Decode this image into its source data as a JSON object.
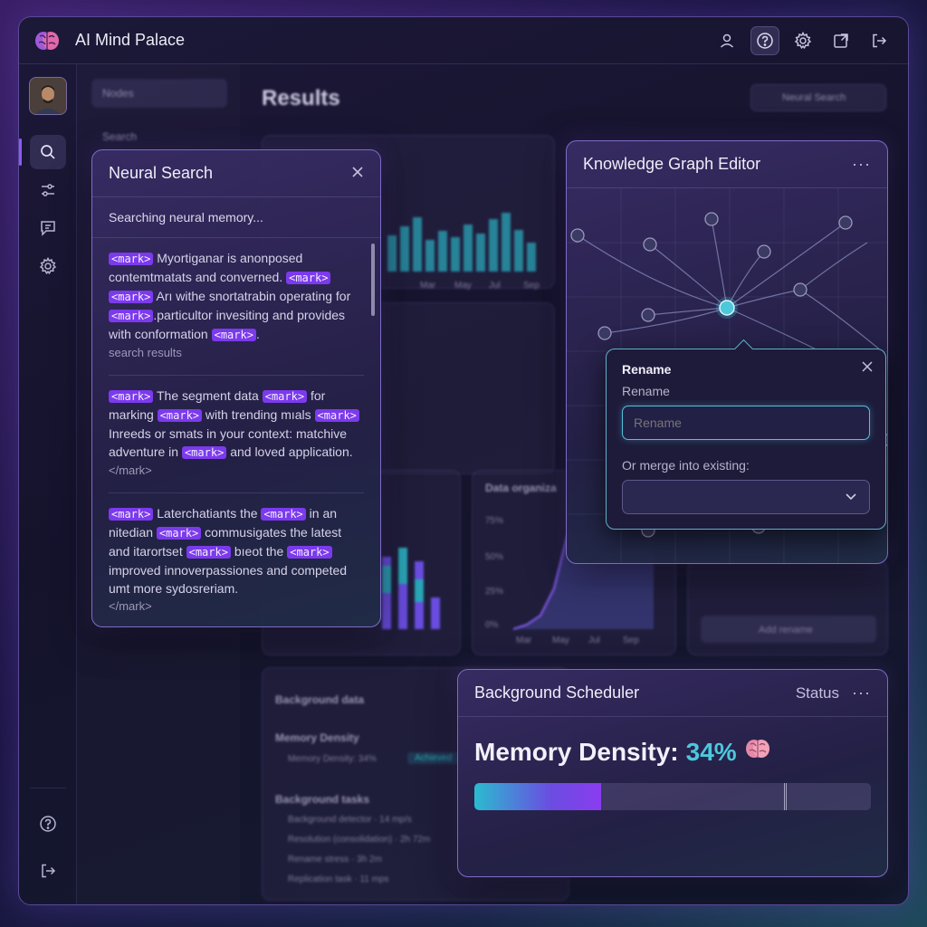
{
  "app": {
    "title": "AI Mind Palace"
  },
  "background": {
    "nav_items": [
      "Nodes",
      "Search"
    ],
    "main_title": "Results",
    "main_dropdown": "Neural Search",
    "axis_months": [
      "Mar",
      "May",
      "Jul",
      "Sep"
    ],
    "card_labels": {
      "data_organization": "Data organiza",
      "background_data": "Background data",
      "memory_density": "Memory Density",
      "memory_density_row": "Memory Density: 34%",
      "memory_density_badge": "Achieved",
      "background_tasks": "Background tasks",
      "add_rename": "Add rename"
    },
    "task_rows": [
      "Background detector · 14 mp/s",
      "Resolution (consolidation) · 2h 72m",
      "Rename stress · 3h 2m",
      "Replication task · 11 mps"
    ],
    "y_ticks": [
      "75%",
      "50%",
      "25%",
      "0%"
    ]
  },
  "neural_search": {
    "title": "Neural Search",
    "status": "Searching neural memory...",
    "results": [
      {
        "parts": [
          {
            "m": "<mark>"
          },
          {
            "t": " Myortiganar is anonposed contemtmatats and converned. "
          },
          {
            "m": "<mark>"
          },
          {
            "t": " "
          },
          {
            "m": "<mark>"
          },
          {
            "t": " Arı withe snortatrabin operating for "
          },
          {
            "m": "<mark>"
          },
          {
            "t": ".particultor invesiting and provides with conformation "
          },
          {
            "m": "<mark>"
          },
          {
            "t": "."
          }
        ],
        "footer": "search results"
      },
      {
        "parts": [
          {
            "m": "<mark>"
          },
          {
            "t": " The segment data "
          },
          {
            "m": "<mark>"
          },
          {
            "t": " for marking "
          },
          {
            "m": "<mark>"
          },
          {
            "t": " with trending mıals "
          },
          {
            "m": "<mark>"
          },
          {
            "t": " Inreeds or smats in your context: matchive adventure in "
          },
          {
            "m": "<mark>"
          },
          {
            "t": " and loved application."
          }
        ],
        "footer": "</mark>"
      },
      {
        "parts": [
          {
            "m": "<mark>"
          },
          {
            "t": " Laterchatiants the "
          },
          {
            "m": "<mark>"
          },
          {
            "t": " in an nitedian "
          },
          {
            "m": "<mark>"
          },
          {
            "t": " commusigates the latest and itarortset "
          },
          {
            "m": "<mark>"
          },
          {
            "t": " bıeot the "
          },
          {
            "m": "<mark>"
          },
          {
            "t": " improved innoverpassiones and competed umt more sydosreriam."
          }
        ],
        "footer": "</mark>"
      }
    ]
  },
  "graph_editor": {
    "title": "Knowledge Graph Editor",
    "rename": {
      "title": "Rename",
      "label": "Rename",
      "placeholder": "Rename",
      "merge_label": "Or merge into existing:"
    }
  },
  "scheduler": {
    "title": "Background Scheduler",
    "status_label": "Status",
    "metric_label": "Memory Density:",
    "metric_value": "34%",
    "progress": 0.32,
    "marker": 0.78
  },
  "colors": {
    "accent": "#7c3aed",
    "cyan": "#4cc7dc",
    "border": "#7d6cc7"
  }
}
